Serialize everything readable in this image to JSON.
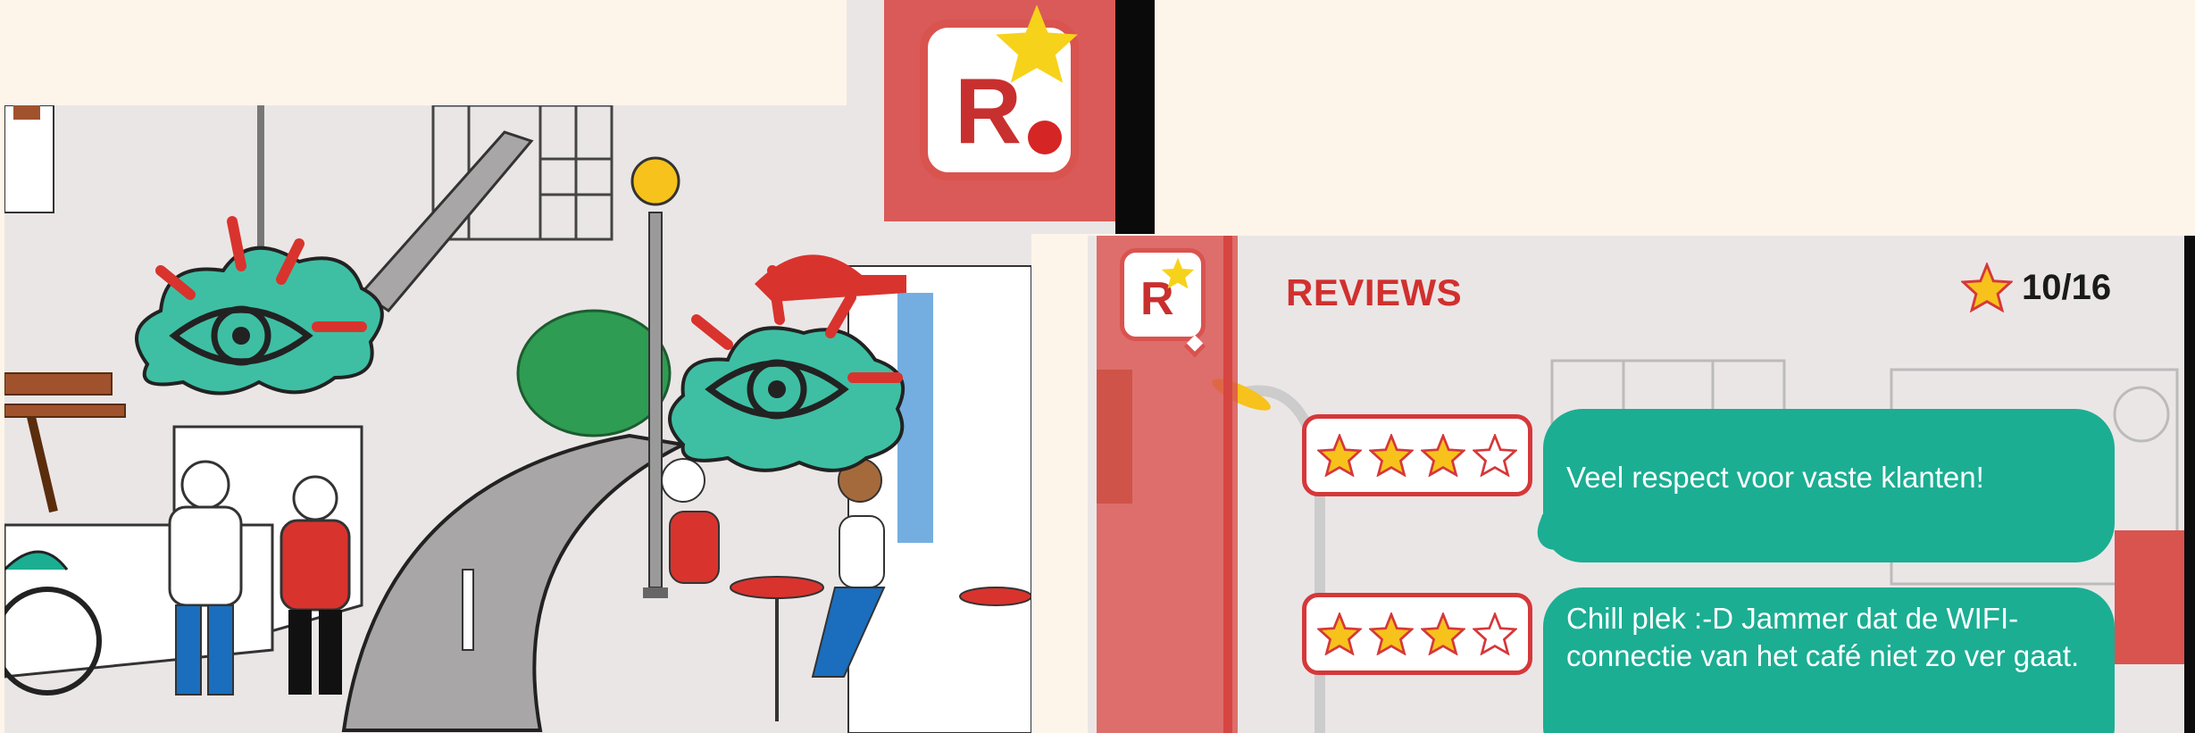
{
  "reviews_panel": {
    "title": "REVIEWS",
    "score_icon": "star-icon",
    "score": "10/16",
    "items": [
      {
        "rating": 3,
        "max_rating": 4,
        "text": "Veel respect voor vaste klanten!"
      },
      {
        "rating": 3,
        "max_rating": 4,
        "text": "Chill plek :-D Jammer dat de WIFI-connectie van het café niet zo ver gaat."
      }
    ]
  },
  "logo": {
    "letter": "R"
  },
  "mini_logo": {
    "letter": "R"
  },
  "scene": {
    "thought_bubble_icon": "eye-icon",
    "thought_bubbles": 2
  },
  "colors": {
    "brand_red": "#d0302e",
    "accent_teal": "#1bae93",
    "star_yellow": "#f7c21b",
    "background_cream": "#fdf5ea"
  }
}
